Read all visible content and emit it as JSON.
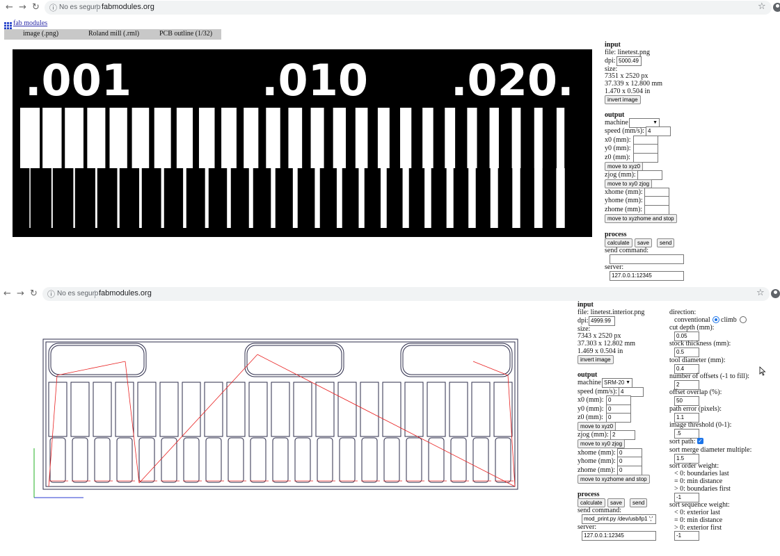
{
  "browser": {
    "insecure_label": "No es seguro",
    "url": "fabmodules.org"
  },
  "app": {
    "link": "fab modules",
    "tabs": [
      "image (.png)",
      "Roland mill (.rml)",
      "PCB outline (1/32)"
    ]
  },
  "top": {
    "image_labels": [
      ".001",
      ".010",
      ".020."
    ],
    "input": {
      "heading": "input",
      "file": "file: linetest.png",
      "dpi_label": "dpi:",
      "dpi": "5000.49",
      "size_label": "size:",
      "px": "7351 x 2520 px",
      "mm": "37.339 x 12.800 mm",
      "in": "1.470 x 0.504 in",
      "invert": "invert image"
    },
    "output": {
      "heading": "output",
      "machine": "machine",
      "speed_label": "speed (mm/s):",
      "speed": "4",
      "x0": "x0 (mm):",
      "y0": "y0 (mm):",
      "z0": "z0 (mm):",
      "move_xyz0": "move to xyz0",
      "zjog": "zjog (mm):",
      "move_xy0_zjog": "move to xy0 zjog",
      "xhome": "xhome (mm):",
      "yhome": "yhome (mm):",
      "zhome": "zhome (mm):",
      "move_home": "move to xyzhome and stop"
    },
    "process": {
      "heading": "process",
      "calculate": "calculate",
      "save": "save",
      "send": "send",
      "send_command": "send command:",
      "server_label": "server:",
      "server": "127.0.0.1:12345"
    }
  },
  "bottom": {
    "input": {
      "heading": "input",
      "file": "file: linetest.interior.png",
      "dpi_label": "dpi:",
      "dpi": "4999.99",
      "size_label": "size:",
      "px": "7343 x 2520 px",
      "mm": "37.303 x 12.802 mm",
      "in": "1.469 x 0.504 in",
      "invert": "invert image"
    },
    "output": {
      "heading": "output",
      "machine": "machine",
      "machine_value": "SRM-20",
      "speed_label": "speed (mm/s):",
      "speed": "4",
      "x0": "x0 (mm):",
      "x0_value": "0",
      "y0": "y0 (mm):",
      "y0_value": "0",
      "z0": "z0 (mm):",
      "z0_value": "0",
      "move_xyz0": "move to xyz0",
      "zjog": "zjog (mm):",
      "zjog_value": "2",
      "move_xy0_zjog": "move to xy0 zjog",
      "xhome": "xhome (mm):",
      "xhome_value": "0",
      "yhome": "yhome (mm):",
      "yhome_value": "0",
      "zhome": "zhome (mm):",
      "zhome_value": "0",
      "move_home": "move to xyzhome and stop"
    },
    "process": {
      "heading": "process",
      "calculate": "calculate",
      "save": "save",
      "send": "send",
      "send_command": "send command:",
      "command": "mod_print.py /dev/usb/lp1 ';'",
      "server_label": "server:",
      "server": "127.0.0.1:12345"
    },
    "settings": {
      "direction": "direction:",
      "conventional": "conventional",
      "climb": "climb",
      "cut_depth": "cut depth (mm):",
      "cut_depth_value": "0.05",
      "stock": "stock thickness (mm):",
      "stock_value": "0.5",
      "tool": "tool diameter (mm):",
      "tool_value": "0.4",
      "offsets": "number of offsets (-1 to fill):",
      "offsets_value": "2",
      "overlap": "offset overlap (%):",
      "overlap_value": "50",
      "path_error": "path error (pixels):",
      "path_error_value": "1.1",
      "threshold": "image threshold (0-1):",
      "threshold_value": ".5",
      "sort_path": "sort path:",
      "merge": "sort merge diameter multiple:",
      "merge_value": "1.5",
      "order_weight": "sort order weight:",
      "order_lt": "< 0: boundaries last",
      "order_eq": "= 0: min distance",
      "order_gt": "> 0: boundaries first",
      "order_value": "-1",
      "seq_weight": "sort sequence weight:",
      "seq_lt": "< 0: exterior last",
      "seq_eq": "= 0: min distance",
      "seq_gt": "> 0: exterior first",
      "seq_value": "-1"
    }
  }
}
